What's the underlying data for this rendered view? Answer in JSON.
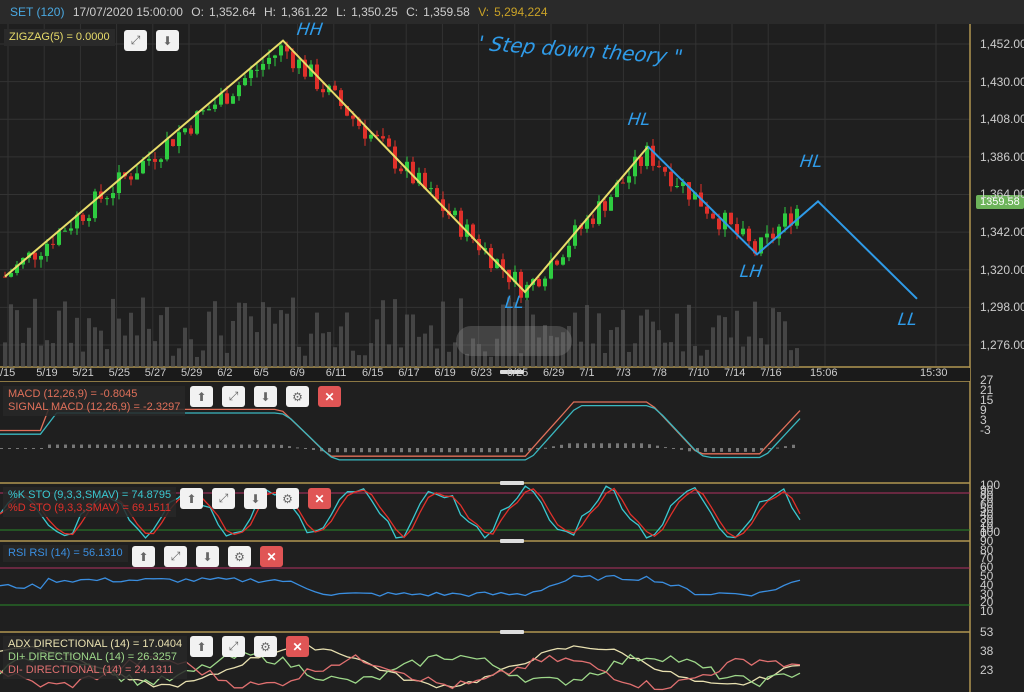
{
  "header": {
    "symbol": "SET (120)",
    "datetime": "17/07/2020 15:00:00",
    "o_label": "O:",
    "open": "1,352.64",
    "h_label": "H:",
    "high": "1,361.22",
    "l_label": "L:",
    "low": "1,350.25",
    "c_label": "C:",
    "close": "1,359.58",
    "v_label": "V:",
    "volume": "5,294,224"
  },
  "main": {
    "indicator": "ZIGZAG(5) = 0.0000",
    "price_ticks": [
      "1,452.00",
      "1,430.00",
      "1,408.00",
      "1,386.00",
      "1,364.00",
      "1,342.00",
      "1,320.00",
      "1,298.00",
      "1,276.00"
    ],
    "last_price": "1359.58",
    "x_labels": [
      "/15",
      "5/19",
      "5/21",
      "5/25",
      "5/27",
      "5/29",
      "6/2",
      "6/5",
      "6/9",
      "6/11",
      "6/15",
      "6/17",
      "6/19",
      "6/23",
      "6/25",
      "6/29",
      "7/1",
      "7/3",
      "7/8",
      "7/10",
      "7/14",
      "7/16"
    ],
    "time_labels": [
      "15:06",
      "15:30"
    ],
    "zigzag": [
      1316,
      1454,
      1307,
      1392
    ],
    "annotation_path": [
      1392,
      1329,
      1360,
      1303
    ],
    "annotations": {
      "hh": "HH",
      "ll1": "LL",
      "hl1": "HL",
      "lh": "LH",
      "hl2": "HL",
      "ll2": "LL",
      "title": "' Step down theory \""
    }
  },
  "macd": {
    "line1": "MACD (12,26,9) = -0.8045",
    "line2": "SIGNAL MACD (12,26,9) = -2.3297",
    "ticks": [
      "27",
      "21",
      "15",
      "9",
      "3",
      "-3"
    ]
  },
  "sto": {
    "line1": "%K STO (9,3,3,SMAV) = 74.8795",
    "line2": "%D STO (9,3,3,SMAV) = 69.1511",
    "ticks": [
      "100",
      "90",
      "80",
      "70",
      "60",
      "50",
      "40",
      "30",
      "20",
      "10",
      "0"
    ]
  },
  "rsi": {
    "line1": "RSI RSI (14) = 56.1310",
    "ticks": [
      "100",
      "90",
      "80",
      "70",
      "60",
      "50",
      "40",
      "30",
      "20",
      "10"
    ]
  },
  "adx": {
    "line1": "ADX DIRECTIONAL (14) = 17.0404",
    "line2": "DI+ DIRECTIONAL (14) = 26.3257",
    "line3": "DI- DIRECTIONAL (14) = 24.1311",
    "ticks": [
      "53",
      "38",
      "23"
    ]
  },
  "colors": {
    "up": "#2ecc40",
    "down": "#e0302a",
    "zigzag": "#e8dc6a",
    "hand": "#2f9be8",
    "macd": "#e0705a",
    "signal": "#3ab8c0"
  }
}
